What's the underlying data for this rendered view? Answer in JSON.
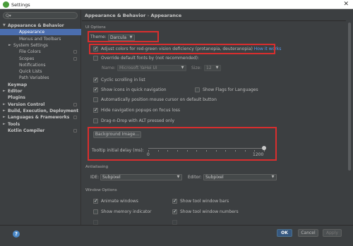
{
  "window": {
    "title": "Settings",
    "close_glyph": "✕"
  },
  "sidebar": {
    "search_placeholder": "",
    "search_icon": "Q▾",
    "items": [
      {
        "label": "Appearance & Behavior",
        "arrow": "▼",
        "bold": true,
        "indent": 0,
        "project": false
      },
      {
        "label": "Appearance",
        "arrow": "",
        "bold": false,
        "indent": 2,
        "selected": true,
        "project": false
      },
      {
        "label": "Menus and Toolbars",
        "arrow": "",
        "bold": false,
        "indent": 2,
        "project": false
      },
      {
        "label": "System Settings",
        "arrow": "►",
        "bold": false,
        "indent": 1,
        "project": false
      },
      {
        "label": "File Colors",
        "arrow": "",
        "bold": false,
        "indent": 2,
        "project": true
      },
      {
        "label": "Scopes",
        "arrow": "",
        "bold": false,
        "indent": 2,
        "project": true
      },
      {
        "label": "Notifications",
        "arrow": "",
        "bold": false,
        "indent": 2,
        "project": false
      },
      {
        "label": "Quick Lists",
        "arrow": "",
        "bold": false,
        "indent": 2,
        "project": false
      },
      {
        "label": "Path Variables",
        "arrow": "",
        "bold": false,
        "indent": 2,
        "project": false
      },
      {
        "label": "Keymap",
        "arrow": "",
        "bold": true,
        "indent": 0,
        "project": false
      },
      {
        "label": "Editor",
        "arrow": "►",
        "bold": true,
        "indent": 0,
        "project": false
      },
      {
        "label": "Plugins",
        "arrow": "",
        "bold": true,
        "indent": 0,
        "project": false
      },
      {
        "label": "Version Control",
        "arrow": "►",
        "bold": true,
        "indent": 0,
        "project": true
      },
      {
        "label": "Build, Execution, Deployment",
        "arrow": "►",
        "bold": true,
        "indent": 0,
        "project": false
      },
      {
        "label": "Languages & Frameworks",
        "arrow": "►",
        "bold": true,
        "indent": 0,
        "project": true
      },
      {
        "label": "Tools",
        "arrow": "►",
        "bold": true,
        "indent": 0,
        "project": false
      },
      {
        "label": "Kotlin Compiler",
        "arrow": "",
        "bold": true,
        "indent": 0,
        "project": true
      }
    ]
  },
  "breadcrumb": {
    "parent": "Appearance & Behavior",
    "sep": "›",
    "current": "Appearance"
  },
  "ui_options": {
    "section": "UI Options",
    "theme_label": "Theme:",
    "theme_value": "Darcula",
    "colorblind": {
      "label": "Adjust colors for red-green vision deficiency (protanopia, deuteranopia)",
      "link": "How it works",
      "checked": true
    },
    "override_fonts": {
      "label": "Override default fonts by (not recommended):",
      "checked": false
    },
    "name_label": "Name:",
    "name_value": "Microsoft YaHei UI",
    "size_label": "Size:",
    "size_value": "12",
    "cyclic": {
      "label": "Cyclic scrolling in list",
      "checked": true
    },
    "show_icons": {
      "label": "Show icons in quick navigation",
      "checked": true
    },
    "show_flags": {
      "label": "Show Flags for Languages",
      "checked": false
    },
    "auto_position": {
      "label": "Automatically position mouse cursor on default button",
      "checked": false
    },
    "hide_popups": {
      "label": "Hide navigation popups on focus loss",
      "checked": true
    },
    "dnd_alt": {
      "label": "Drag-n-Drop with ALT pressed only",
      "checked": false
    },
    "background_button": "Background Image...",
    "tooltip_label": "Tooltip initial delay (ms):",
    "tooltip_min": "0",
    "tooltip_max": "1200",
    "tooltip_value_fraction": 1.0
  },
  "antialiasing": {
    "section": "Antialiasing",
    "ide_label": "IDE:",
    "ide_value": "Subpixel",
    "editor_label": "Editor:",
    "editor_value": "Subpixel"
  },
  "window_options": {
    "section": "Window Options",
    "animate": {
      "label": "Animate windows",
      "checked": true
    },
    "show_tool_bars": {
      "label": "Show tool window bars",
      "checked": true
    },
    "show_memory": {
      "label": "Show memory indicator",
      "checked": false
    },
    "show_tool_numbers": {
      "label": "Show tool window numbers",
      "checked": true
    }
  },
  "footer": {
    "help": "?",
    "ok": "OK",
    "cancel": "Cancel",
    "apply": "Apply"
  },
  "colors": {
    "accent": "#4b6eaf",
    "annotation": "#d92e2e",
    "link": "#589df6"
  }
}
